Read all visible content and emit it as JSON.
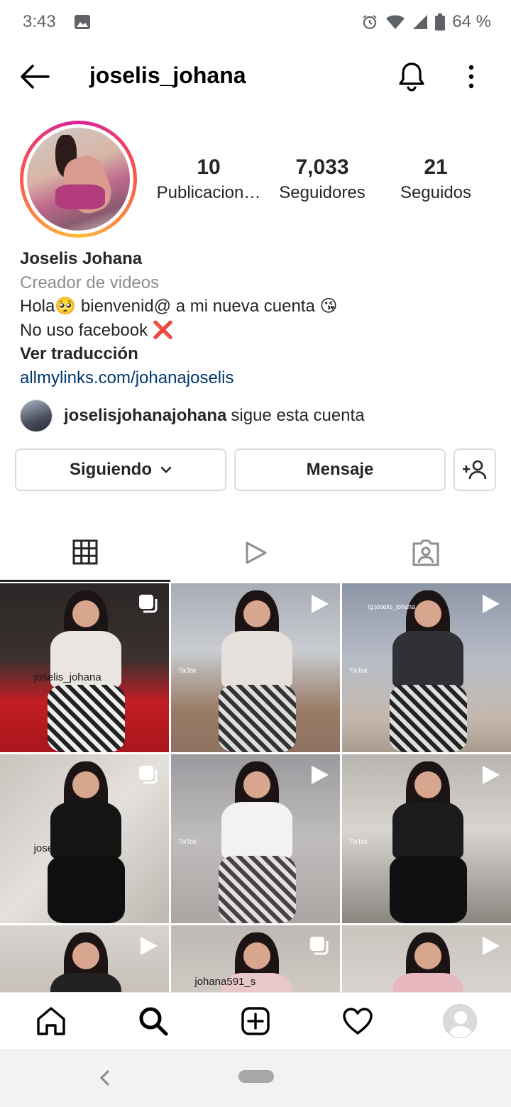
{
  "status_bar": {
    "time": "3:43",
    "battery": "64 %",
    "icons": [
      "image-icon",
      "alarm-icon",
      "wifi-icon",
      "signal-icon",
      "battery-icon"
    ]
  },
  "header": {
    "username": "joselis_johana",
    "icons": [
      "back-arrow-icon",
      "bell-icon",
      "more-vertical-icon"
    ]
  },
  "profile": {
    "stats": [
      {
        "value": "10",
        "label": "Publicacion…"
      },
      {
        "value": "7,033",
        "label": "Seguidores"
      },
      {
        "value": "21",
        "label": "Seguidos"
      }
    ],
    "name": "Joselis Johana",
    "category": "Creador de videos",
    "bio_line_1": "Hola🥺 bienvenid@ a mi nueva cuenta 😘",
    "bio_line_2": "No uso facebook ❌",
    "translate": "Ver traducción",
    "link": "allmylinks.com/johanajoselis",
    "followed_by_user": "joselisjohanajohana",
    "followed_by_suffix": "sigue esta cuenta"
  },
  "actions": {
    "following": "Siguiendo",
    "message": "Mensaje"
  },
  "tabs": [
    "grid-icon",
    "reels-icon",
    "tagged-icon"
  ],
  "grid": {
    "tiles": [
      {
        "type": "multiple",
        "caption": "joselis_johana"
      },
      {
        "type": "video",
        "caption": "TikTok"
      },
      {
        "type": "video",
        "caption": "TikTok",
        "overlay": "Ig:joselis_johana"
      },
      {
        "type": "multiple",
        "caption": "joselis_johana"
      },
      {
        "type": "video",
        "caption": "TikTok"
      },
      {
        "type": "video",
        "caption": "TikTok"
      },
      {
        "type": "video",
        "caption": ""
      },
      {
        "type": "multiple",
        "caption": "johana591_s"
      },
      {
        "type": "video",
        "caption": ""
      }
    ]
  },
  "bottom_nav": [
    "home-icon",
    "search-icon",
    "new-post-icon",
    "activity-heart-icon",
    "profile-avatar"
  ],
  "colors": {
    "link": "#00376b",
    "secondary_text": "#8e8e8e",
    "border": "#dbdbdb",
    "story_ring": "#d6249f"
  }
}
